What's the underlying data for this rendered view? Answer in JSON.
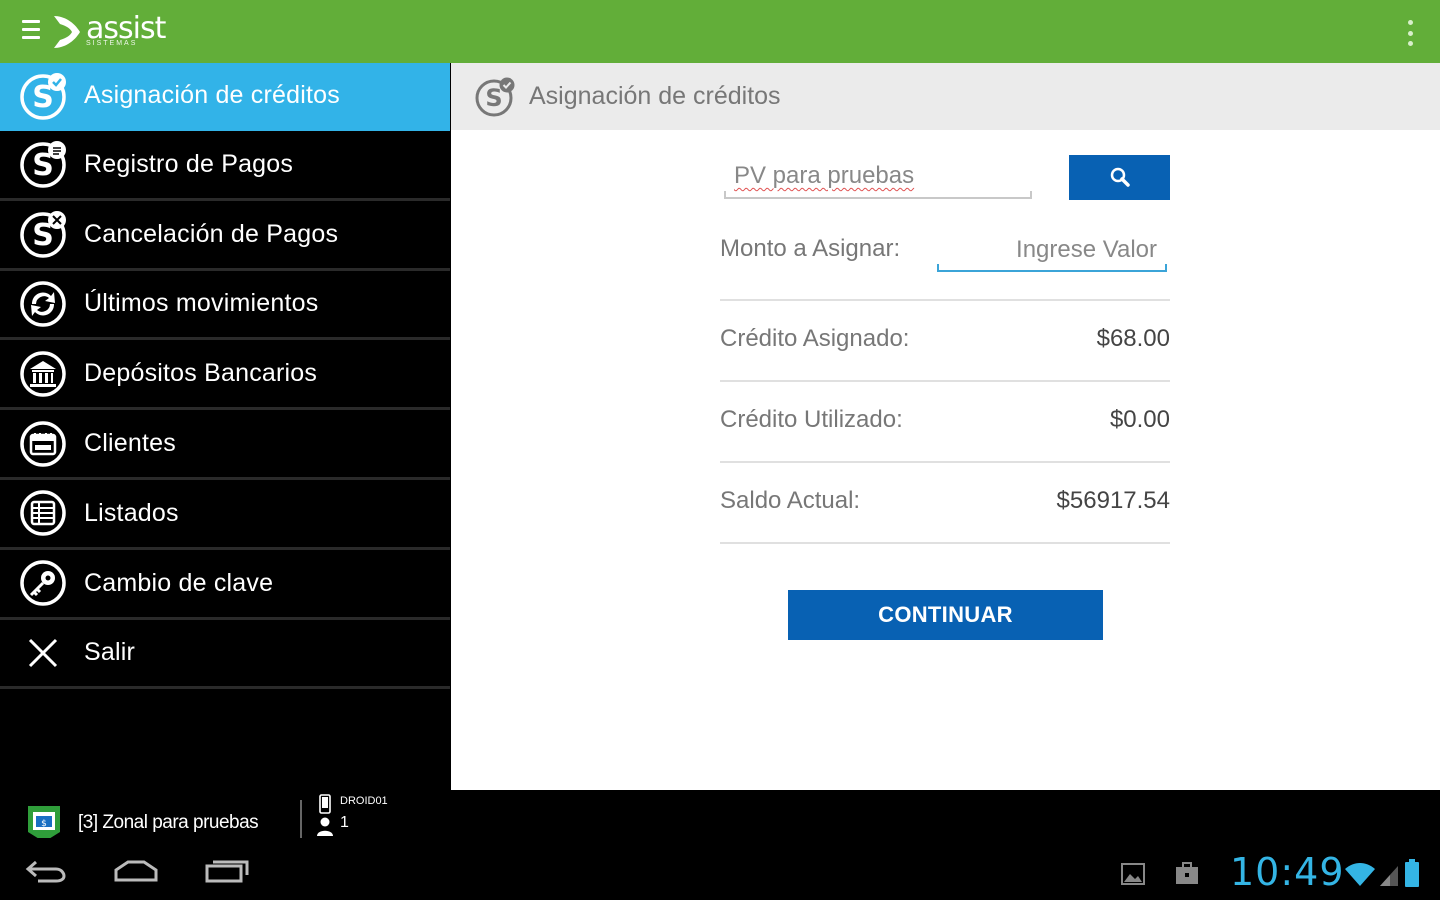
{
  "app": {
    "logo_text": "assist",
    "logo_subtext": "SISTEMAS"
  },
  "colors": {
    "actionbar": "#62ae39",
    "drawer_active": "#32b3e8",
    "primary_button": "#0861b3",
    "clock": "#34b5e5"
  },
  "drawer": {
    "items": [
      {
        "label": "Asignación de créditos",
        "icon": "credit-assign-icon",
        "active": true
      },
      {
        "label": "Registro de Pagos",
        "icon": "payment-register-icon",
        "active": false
      },
      {
        "label": "Cancelación de Pagos",
        "icon": "payment-cancel-icon",
        "active": false
      },
      {
        "label": "Últimos movimientos",
        "icon": "movements-icon",
        "active": false
      },
      {
        "label": "Depósitos Bancarios",
        "icon": "bank-icon",
        "active": false
      },
      {
        "label": "Clientes",
        "icon": "clients-icon",
        "active": false
      },
      {
        "label": "Listados",
        "icon": "list-icon",
        "active": false
      },
      {
        "label": "Cambio de clave",
        "icon": "key-icon",
        "active": false
      },
      {
        "label": "Salir",
        "icon": "close-icon",
        "active": false
      }
    ],
    "footer": {
      "zone": "[3] Zonal para pruebas",
      "device": "DROID01",
      "user_count": "1"
    }
  },
  "content": {
    "title": "Asignación de créditos",
    "search": {
      "value": "PV para pruebas"
    },
    "amount": {
      "label": "Monto a Asignar:",
      "placeholder": "Ingrese Valor"
    },
    "rows": [
      {
        "label": "Crédito Asignado:",
        "value": "$68.00"
      },
      {
        "label": "Crédito Utilizado:",
        "value": "$0.00"
      },
      {
        "label": "Saldo Actual:",
        "value": "$56917.54"
      }
    ],
    "continue_label": "CONTINUAR"
  },
  "system": {
    "clock": "10:49"
  }
}
